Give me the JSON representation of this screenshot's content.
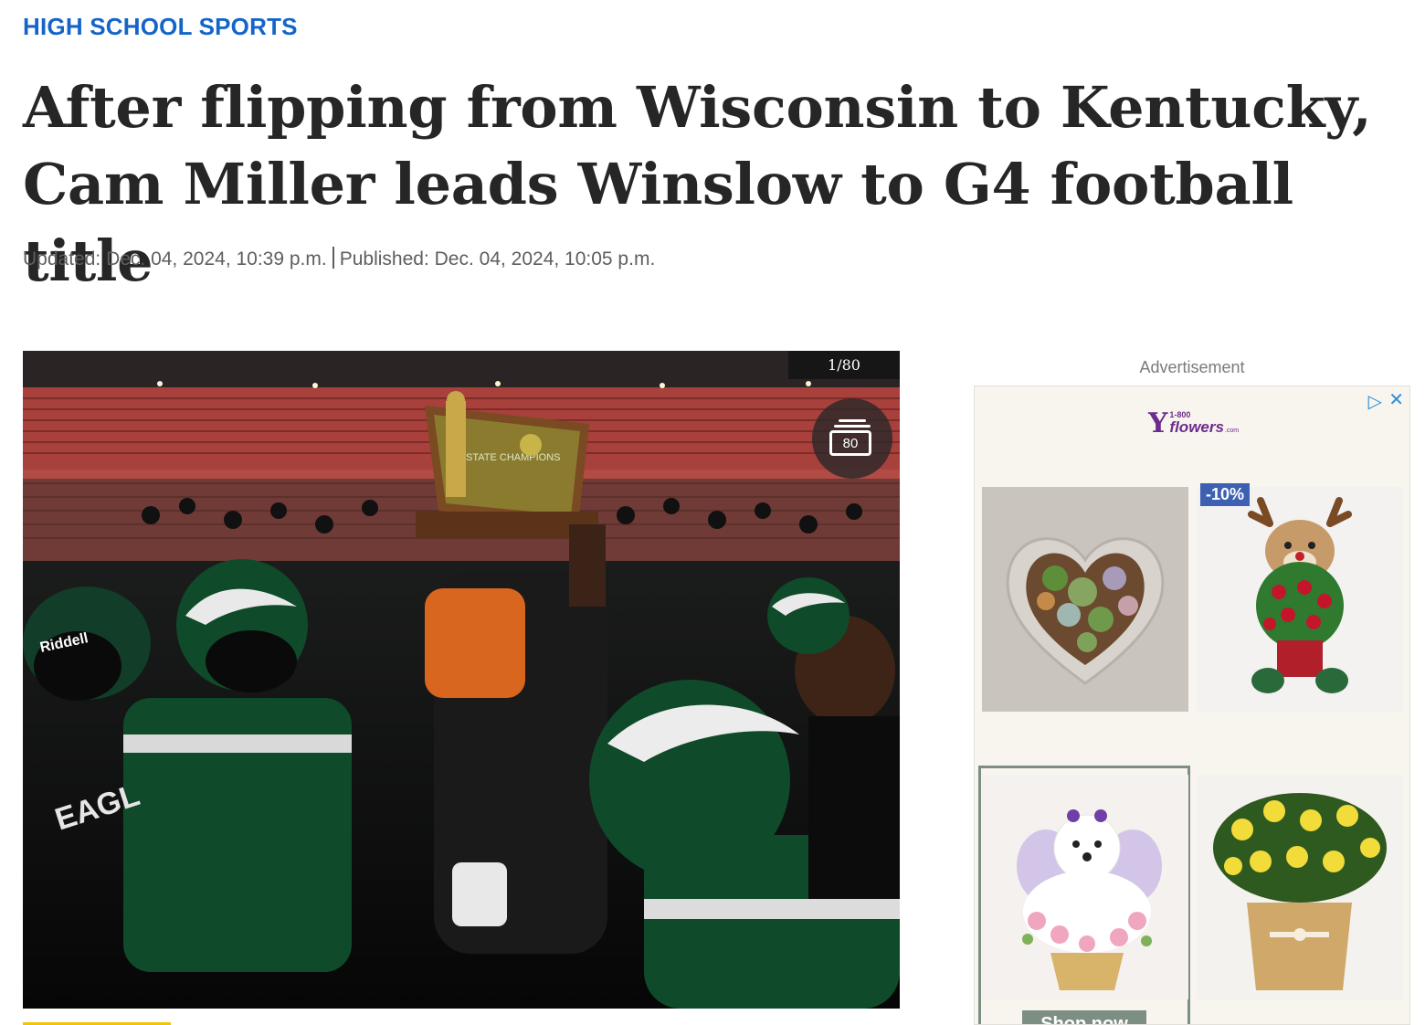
{
  "article": {
    "section": "HIGH SCHOOL SPORTS",
    "headline": "After flipping from Wisconsin to Kentucky, Cam Miller leads Winslow to G4 football title",
    "updated": "Updated: Dec. 04, 2024, 10:39 p.m.",
    "published": "Published: Dec. 04, 2024, 10:05 p.m."
  },
  "gallery": {
    "counter": "1/80",
    "photo_count": "80",
    "photo": {
      "helmet_brand": "Riddell",
      "jersey_text": "EAGLES",
      "trophy_text": "STATE CHAMPIONS"
    }
  },
  "ad": {
    "label": "Advertisement",
    "brand_number": "1-800",
    "brand_name": "flowers",
    "brand_tld": ".com",
    "discount": "-10%",
    "cta": "Shop now"
  },
  "colors": {
    "section": "#1565c9",
    "headline": "#262626",
    "team_green": "#0f4a2a",
    "brand_purple": "#6c2c8e",
    "discount_bg": "#3d60b3",
    "cta_bg": "#7d8e83"
  }
}
